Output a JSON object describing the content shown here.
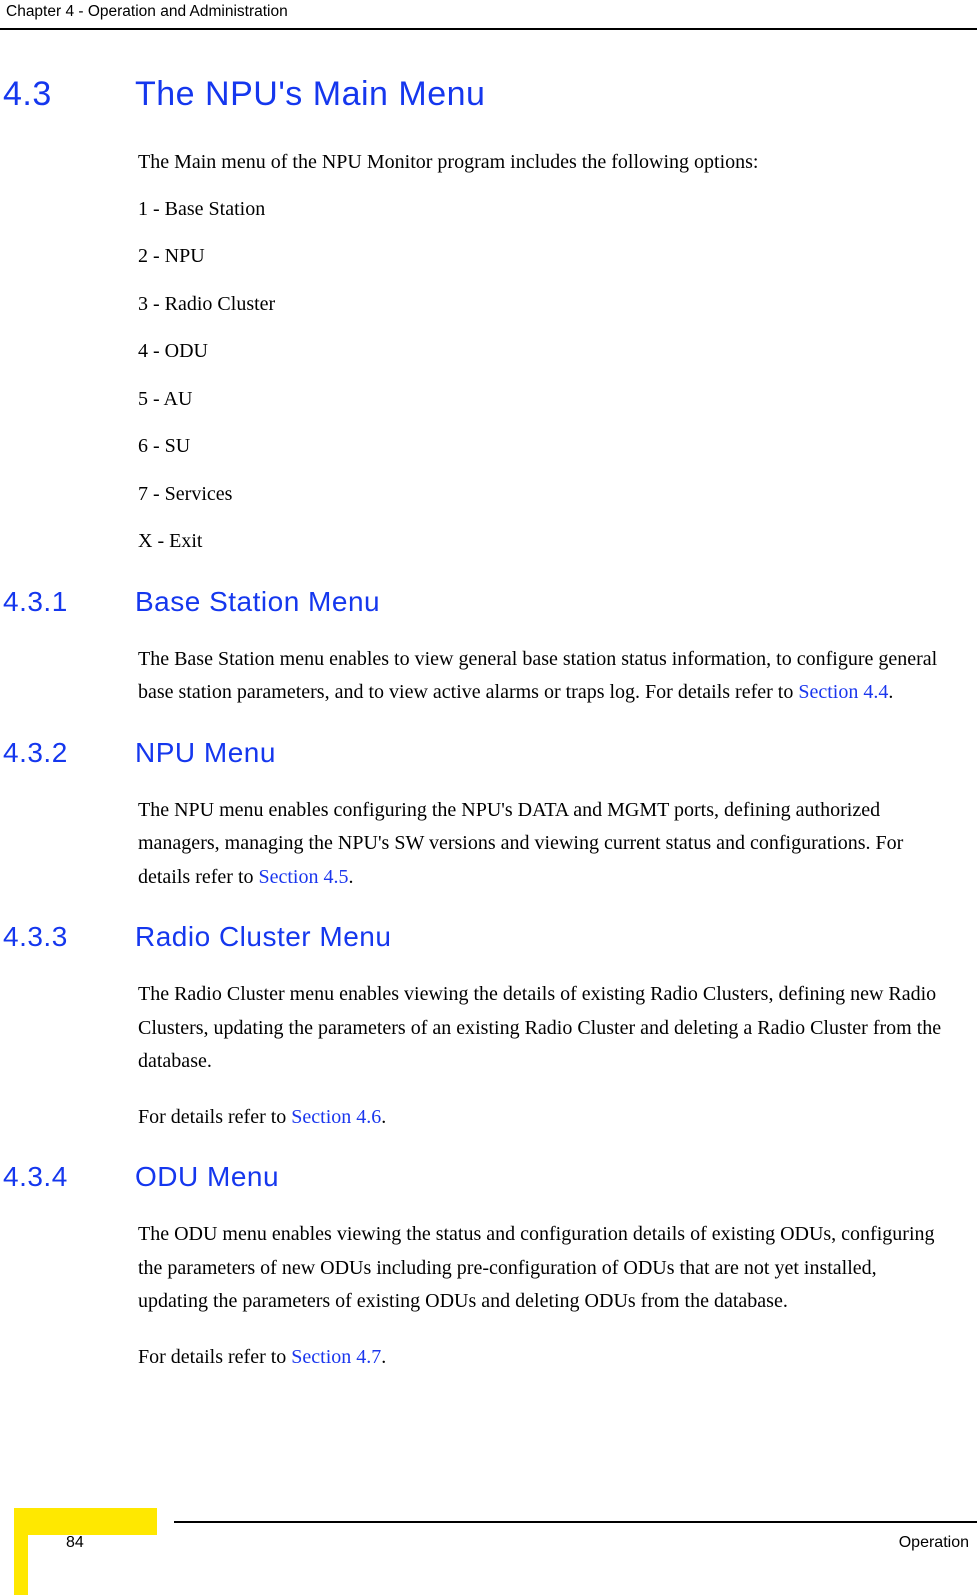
{
  "header": {
    "running_head": "Chapter 4 - Operation and Administration"
  },
  "colors": {
    "heading_blue": "#1537ee",
    "xref_blue": "#1a36ee",
    "corner_yellow": "#ffe800",
    "body_black": "#000000"
  },
  "sections": {
    "s43": {
      "number": "4.3",
      "title": "The NPU's Main Menu",
      "intro": "The Main menu of the NPU Monitor program includes the following options:",
      "menu_items": [
        "1 - Base Station",
        "2 - NPU",
        "3 - Radio Cluster",
        "4 - ODU",
        "5 - AU",
        "6 - SU",
        "7 - Services",
        "X - Exit"
      ]
    },
    "s431": {
      "number": "4.3.1",
      "title": "Base Station Menu",
      "body_before": "The Base Station menu enables to view general base station status information, to configure general base station parameters, and to view active alarms or traps log. For details refer to ",
      "xref": "Section 4.4",
      "body_after": "."
    },
    "s432": {
      "number": "4.3.2",
      "title": "NPU Menu",
      "body_before": "The NPU menu enables configuring the NPU's DATA and MGMT ports, defining authorized managers, managing the NPU's SW versions and viewing current status and configurations. For details refer to ",
      "xref": "Section 4.5",
      "body_after": "."
    },
    "s433": {
      "number": "4.3.3",
      "title": "Radio Cluster Menu",
      "body": "The Radio Cluster menu enables viewing the details of existing Radio Clusters, defining new Radio Clusters, updating the parameters of an existing Radio Cluster and deleting a Radio Cluster from the database.",
      "refs_before": "For details refer to ",
      "xref": "Section 4.6",
      "refs_after": "."
    },
    "s434": {
      "number": "4.3.4",
      "title": "ODU Menu",
      "body": " The ODU menu enables viewing the status and configuration details of existing ODUs, configuring the parameters of new ODUs including pre-configuration of ODUs that are not yet installed, updating the parameters of existing ODUs and deleting ODUs from the database.",
      "refs_before": "For details refer to ",
      "xref": "Section 4.7",
      "refs_after": "."
    }
  },
  "footer": {
    "page_number": "84",
    "right_label": "Operation"
  }
}
